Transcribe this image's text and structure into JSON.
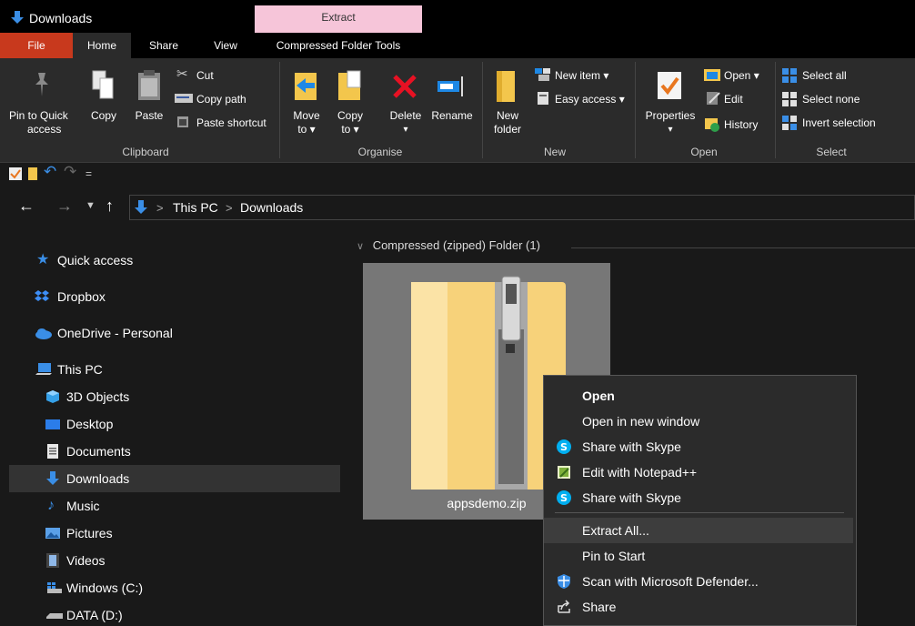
{
  "window": {
    "title": "Downloads",
    "context_tab": "Extract"
  },
  "tabs": {
    "file": "File",
    "home": "Home",
    "share": "Share",
    "view": "View",
    "cft": "Compressed Folder Tools"
  },
  "ribbon": {
    "clipboard": {
      "pin": [
        "Pin to Quick",
        "access"
      ],
      "copy": "Copy",
      "paste": "Paste",
      "cut": "Cut",
      "copy_path": "Copy path",
      "paste_shortcut": "Paste shortcut",
      "group": "Clipboard"
    },
    "organise": {
      "move": [
        "Move",
        "to ▾"
      ],
      "copy": [
        "Copy",
        "to ▾"
      ],
      "delete": "Delete",
      "delete_arrow": "▾",
      "rename": "Rename",
      "group": "Organise"
    },
    "new": {
      "new_folder": [
        "New",
        "folder"
      ],
      "new_item": "New item ▾",
      "easy_access": "Easy access ▾",
      "group": "New"
    },
    "open": {
      "properties": "Properties",
      "properties_arrow": "▾",
      "open": "Open ▾",
      "edit": "Edit",
      "history": "History",
      "group": "Open"
    },
    "select": {
      "select_all": "Select all",
      "select_none": "Select none",
      "invert": "Invert selection",
      "group": "Select"
    }
  },
  "qat": {
    "dropdown": "="
  },
  "address": {
    "path": [
      "This PC",
      "Downloads"
    ],
    "sep": ">"
  },
  "nav": [
    {
      "label": "Quick access"
    },
    {
      "label": "Dropbox"
    },
    {
      "label": "OneDrive - Personal"
    },
    {
      "label": "This PC"
    },
    {
      "label": "3D Objects"
    },
    {
      "label": "Desktop"
    },
    {
      "label": "Documents"
    },
    {
      "label": "Downloads"
    },
    {
      "label": "Music"
    },
    {
      "label": "Pictures"
    },
    {
      "label": "Videos"
    },
    {
      "label": "Windows (C:)"
    },
    {
      "label": "DATA (D:)"
    }
  ],
  "content": {
    "group_header": "Compressed (zipped) Folder (1)",
    "file_name": "appsdemo.zip"
  },
  "context_menu": [
    {
      "label": "Open"
    },
    {
      "label": "Open in new window"
    },
    {
      "label": "Share with Skype"
    },
    {
      "label": "Edit with Notepad++"
    },
    {
      "label": "Share with Skype"
    },
    {
      "label": "Extract All..."
    },
    {
      "label": "Pin to Start"
    },
    {
      "label": "Scan with Microsoft Defender..."
    },
    {
      "label": "Share"
    }
  ],
  "colors": {
    "accent": "#0078d7",
    "file_tab": "#c8391d",
    "context_tab": "#f6c5d9"
  }
}
